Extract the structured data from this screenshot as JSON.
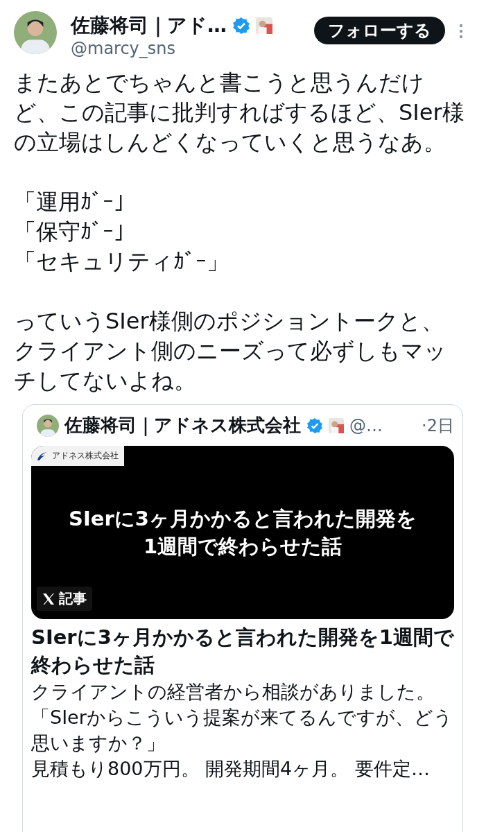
{
  "author": {
    "name": "佐藤将司｜アド…",
    "handle": "@marcy_sns",
    "verified": true
  },
  "follow_button": "フォローする",
  "body": [
    {
      "kind": "paragraph",
      "text": "またあとでちゃんと書こうと思うんだけど、この記事に批判すればするほど、SIer様の立場はしんどくなっていくと思うなあ。"
    },
    {
      "kind": "line",
      "text": "「運用ｶﾞｰ」"
    },
    {
      "kind": "line",
      "text": "「保守ｶﾞｰ」"
    },
    {
      "kind": "line",
      "text": "「セキュリティｶﾞｰ」"
    },
    {
      "kind": "paragraph",
      "text": "っていうSIer様側のポジショントークと、クライアント側のニーズって必ずしもマッチしてないよね。"
    }
  ],
  "quote": {
    "author": "佐藤将司｜アドネス株式会社",
    "verified": true,
    "handle": "@…",
    "time": "·2日",
    "cover": {
      "company": "アドネス株式会社",
      "headline": [
        "SIerに3ヶ月かかると言われた開発を",
        "1週間で終わらせた話"
      ],
      "badge": "記事"
    },
    "title": "SIerに3ヶ月かかると言われた開発を1週間で終わらせた話",
    "description": [
      "クライアントの経営者から相談がありました。",
      "「SIerからこういう提案が来てるんですが、どう思いますか？」",
      "見積もり800万円。 開発期間4ヶ月。 要件定…"
    ]
  }
}
